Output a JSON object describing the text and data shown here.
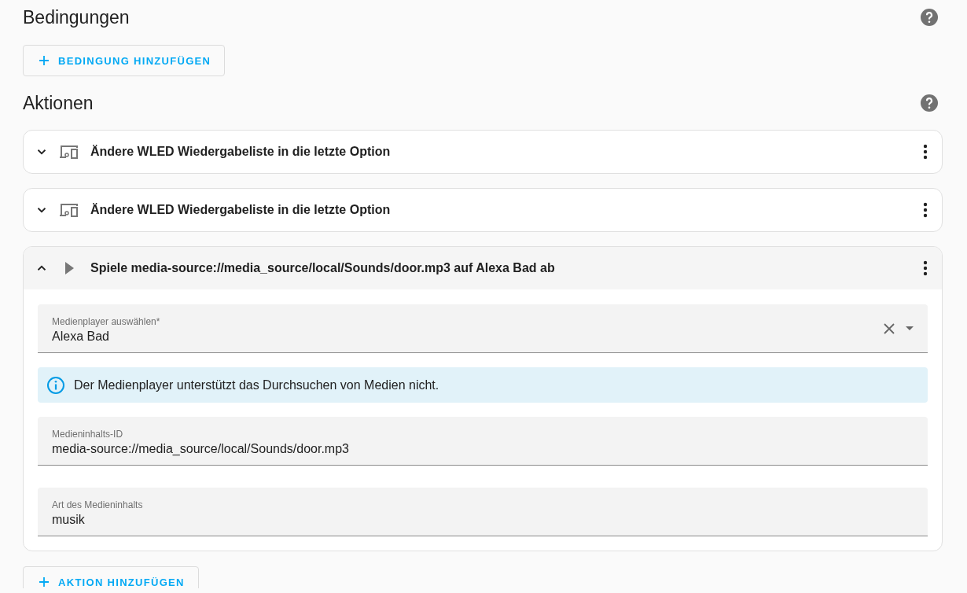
{
  "conditions": {
    "title": "Bedingungen",
    "add_button": "BEDINGUNG HINZUFÜGEN"
  },
  "actions_section": {
    "title": "Aktionen",
    "add_button": "AKTION HINZUFÜGEN"
  },
  "actions": [
    {
      "kind": "device",
      "title": "Ändere WLED Wiedergabeliste in die letzte Option",
      "expanded": false
    },
    {
      "kind": "device",
      "title": "Ändere WLED Wiedergabeliste in die letzte Option",
      "expanded": false
    },
    {
      "kind": "play",
      "title": "Spiele media-source://media_source/local/Sounds/door.mp3 auf Alexa Bad ab",
      "expanded": true,
      "fields": [
        {
          "kind": "select",
          "label": "Medienplayer auswählen*",
          "value": "Alexa Bad"
        },
        {
          "kind": "alert",
          "text": "Der Medienplayer unterstützt das Durchsuchen von Medien nicht."
        },
        {
          "kind": "text",
          "label": "Medieninhalts-ID",
          "value": "media-source://media_source/local/Sounds/door.mp3"
        },
        {
          "kind": "text",
          "label": "Art des Medieninhalts",
          "value": "musik"
        }
      ]
    }
  ]
}
